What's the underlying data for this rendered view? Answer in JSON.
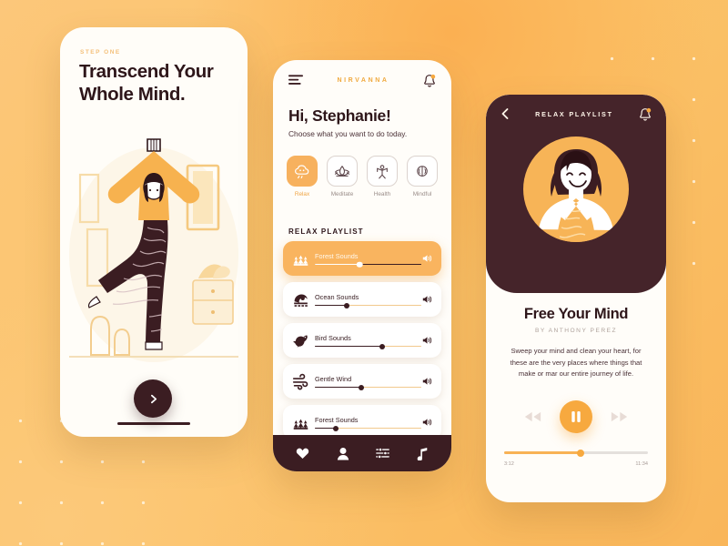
{
  "theme": {
    "background": "#FBC46A",
    "accent_orange": "#F7B15E",
    "dark_maroon": "#3B1D22",
    "card_white": "#FFFDF9"
  },
  "onboarding": {
    "step_label": "STEP ONE",
    "title": "Transcend Your Whole Mind.",
    "next_icon": "chevron-right-icon",
    "illustration": "woman-yoga-tree-pose-illustration"
  },
  "home": {
    "menu_icon": "hamburger-menu-icon",
    "brand": "NIRVANNA",
    "bell_icon": "bell-notification-icon",
    "greeting": "Hi, Stephanie!",
    "subtitle": "Choose what you want to do today.",
    "categories": [
      {
        "label": "Relax",
        "icon": "cloud-relax-icon",
        "active": true
      },
      {
        "label": "Meditate",
        "icon": "lotus-flower-icon",
        "active": false
      },
      {
        "label": "Health",
        "icon": "body-stretch-icon",
        "active": false
      },
      {
        "label": "Mindful",
        "icon": "brain-icon",
        "active": false
      }
    ],
    "section_title": "RELAX PLAYLIST",
    "tracks": [
      {
        "name": "Forest Sounds",
        "icon": "forest-trees-icon",
        "progress": 42,
        "active": true,
        "volume_icon": "speaker-icon"
      },
      {
        "name": "Ocean Sounds",
        "icon": "ocean-wave-icon",
        "progress": 30,
        "active": false,
        "volume_icon": "speaker-icon"
      },
      {
        "name": "Bird Sounds",
        "icon": "bird-icon",
        "progress": 63,
        "active": false,
        "volume_icon": "speaker-icon"
      },
      {
        "name": "Gentle Wind",
        "icon": "wind-icon",
        "progress": 44,
        "active": false,
        "volume_icon": "speaker-icon"
      },
      {
        "name": "Forest Sounds",
        "icon": "forest-trees-icon",
        "progress": 20,
        "active": false,
        "volume_icon": "speaker-icon"
      }
    ],
    "nav": [
      {
        "icon": "heart-icon",
        "name": "favorites"
      },
      {
        "icon": "person-icon",
        "name": "profile"
      },
      {
        "icon": "sliders-icon",
        "name": "settings"
      },
      {
        "icon": "music-note-icon",
        "name": "music"
      }
    ]
  },
  "player": {
    "back_icon": "chevron-left-icon",
    "title": "RELAX PLAYLIST",
    "bell_icon": "bell-notification-icon",
    "avatar": "smiling-woman-avatar-illustration",
    "song": "Free Your Mind",
    "artist": "BY  ANTHONY PEREZ",
    "quote": "Sweep your mind and clean your heart, for these are the very places where things that make or mar our entire journey of life.",
    "controls": {
      "rewind_icon": "rewind-icon",
      "play_icon": "pause-icon",
      "forward_icon": "fast-forward-icon"
    },
    "time_current": "3:12",
    "time_total": "11:34",
    "progress_percent": 53
  }
}
